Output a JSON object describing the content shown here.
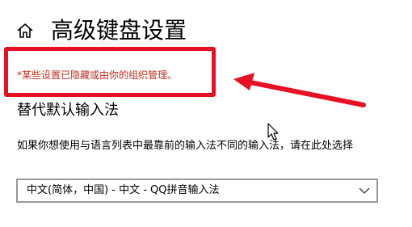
{
  "header": {
    "home_icon": "home-icon",
    "title": "高级键盘设置"
  },
  "notice": {
    "text": "*某些设置已隐藏或由你的组织管理。",
    "text_color": "#c42b1c",
    "highlight_color": "#e81123"
  },
  "override_input": {
    "title": "替代默认输入法",
    "description": "如果你想使用与语言列表中最靠前的输入法不同的输入法，请在此处选择",
    "dropdown": {
      "selected": "中文(简体，中国) - 中文 - QQ拼音输入法",
      "icon": "chevron-down-icon"
    }
  }
}
